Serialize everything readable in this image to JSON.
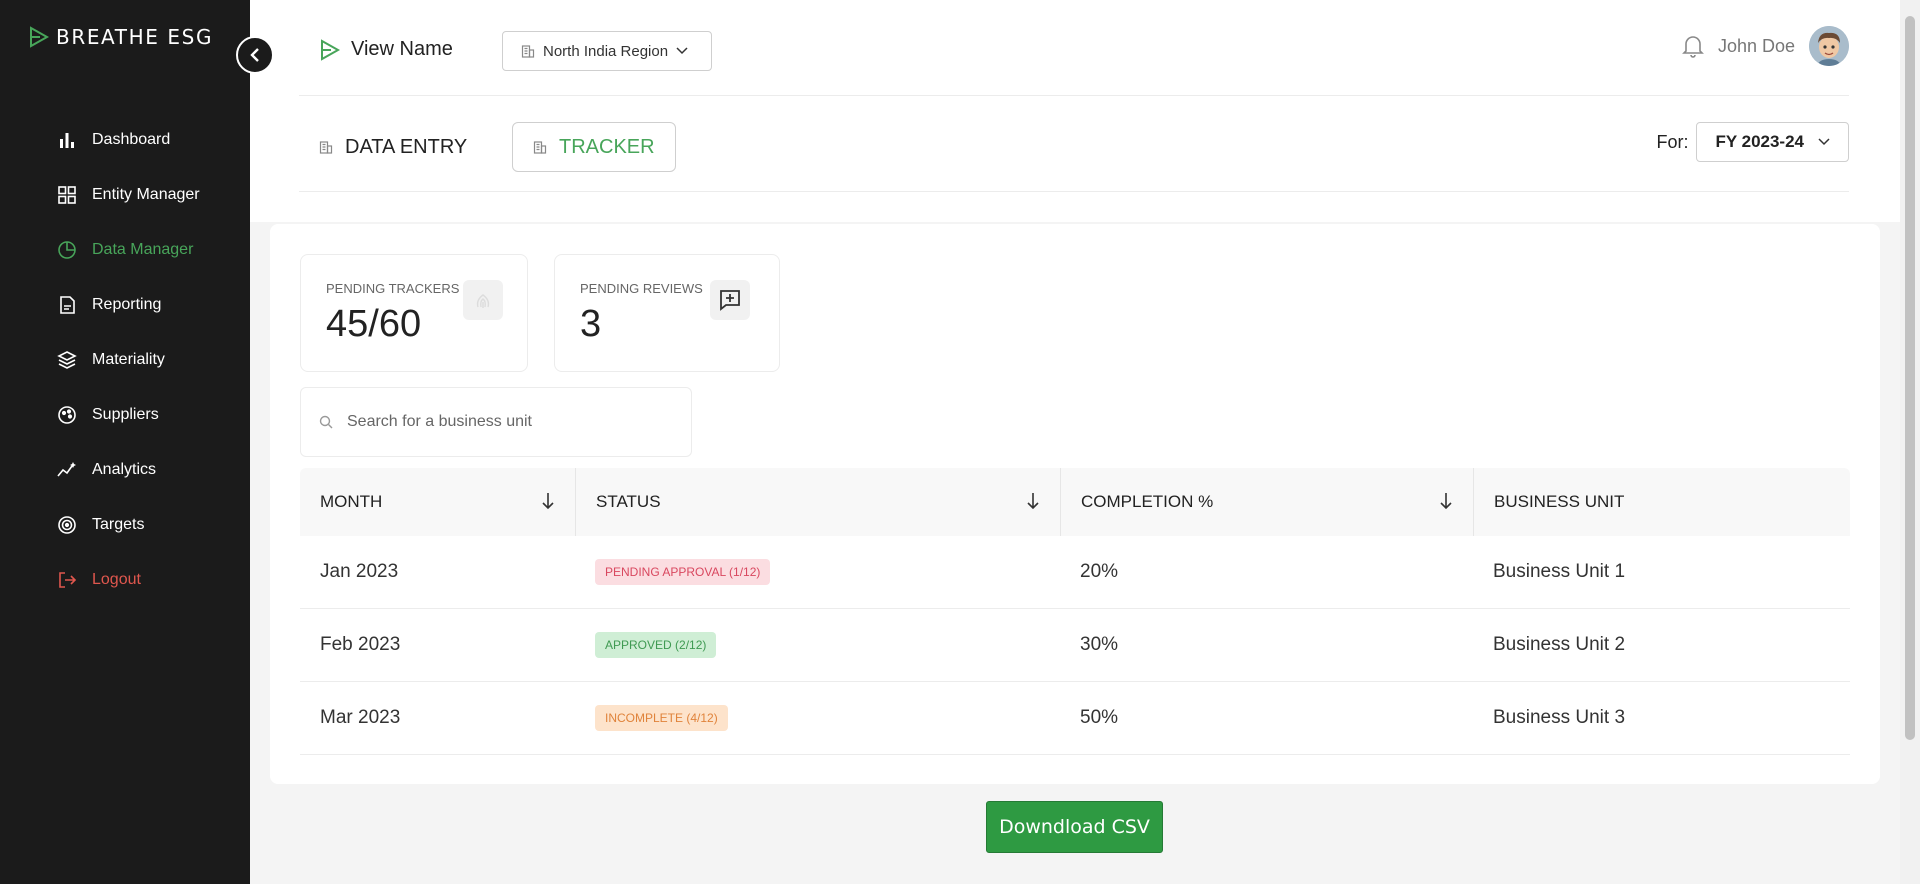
{
  "sidebar": {
    "logo": "BREATHE ESG",
    "items": [
      {
        "label": "Dashboard",
        "icon": "bar-chart-icon"
      },
      {
        "label": "Entity Manager",
        "icon": "grid-icon"
      },
      {
        "label": "Data Manager",
        "icon": "pie-icon",
        "active": true
      },
      {
        "label": "Reporting",
        "icon": "document-icon"
      },
      {
        "label": "Materiality",
        "icon": "layers-icon"
      },
      {
        "label": "Suppliers",
        "icon": "palette-icon"
      },
      {
        "label": "Analytics",
        "icon": "sparkline-icon"
      },
      {
        "label": "Targets",
        "icon": "target-icon"
      },
      {
        "label": "Logout",
        "icon": "logout-icon"
      }
    ]
  },
  "header": {
    "view_name": "View Name",
    "region": "North India Region",
    "user_name": "John Doe"
  },
  "subheader": {
    "tab_data_entry": "DATA ENTRY",
    "tab_tracker": "TRACKER",
    "for_label": "For:",
    "fiscal_year": "FY 2023-24"
  },
  "stats": {
    "pending_trackers_label": "PENDING TRACKERS",
    "pending_trackers_value": "45/60",
    "pending_reviews_label": "PENDING REVIEWS",
    "pending_reviews_value": "3"
  },
  "search": {
    "placeholder": "Search for a business unit"
  },
  "table": {
    "headers": [
      "MONTH",
      "STATUS",
      "COMPLETION %",
      "BUSINESS UNIT"
    ],
    "rows": [
      {
        "month": "Jan 2023",
        "status": "PENDING APPROVAL (1/12)",
        "completion": "20%",
        "unit": "Business Unit 1"
      },
      {
        "month": "Feb 2023",
        "status": "APPROVED (2/12)",
        "completion": "30%",
        "unit": "Business Unit 2"
      },
      {
        "month": "Mar 2023",
        "status": "INCOMPLETE (4/12)",
        "completion": "50%",
        "unit": "Business Unit 3"
      }
    ]
  },
  "download_label": "Downdload CSV",
  "colors": {
    "accent_green": "#48a55a",
    "logout_red": "#e0574e",
    "sidebar_bg": "#1b1b1b"
  }
}
